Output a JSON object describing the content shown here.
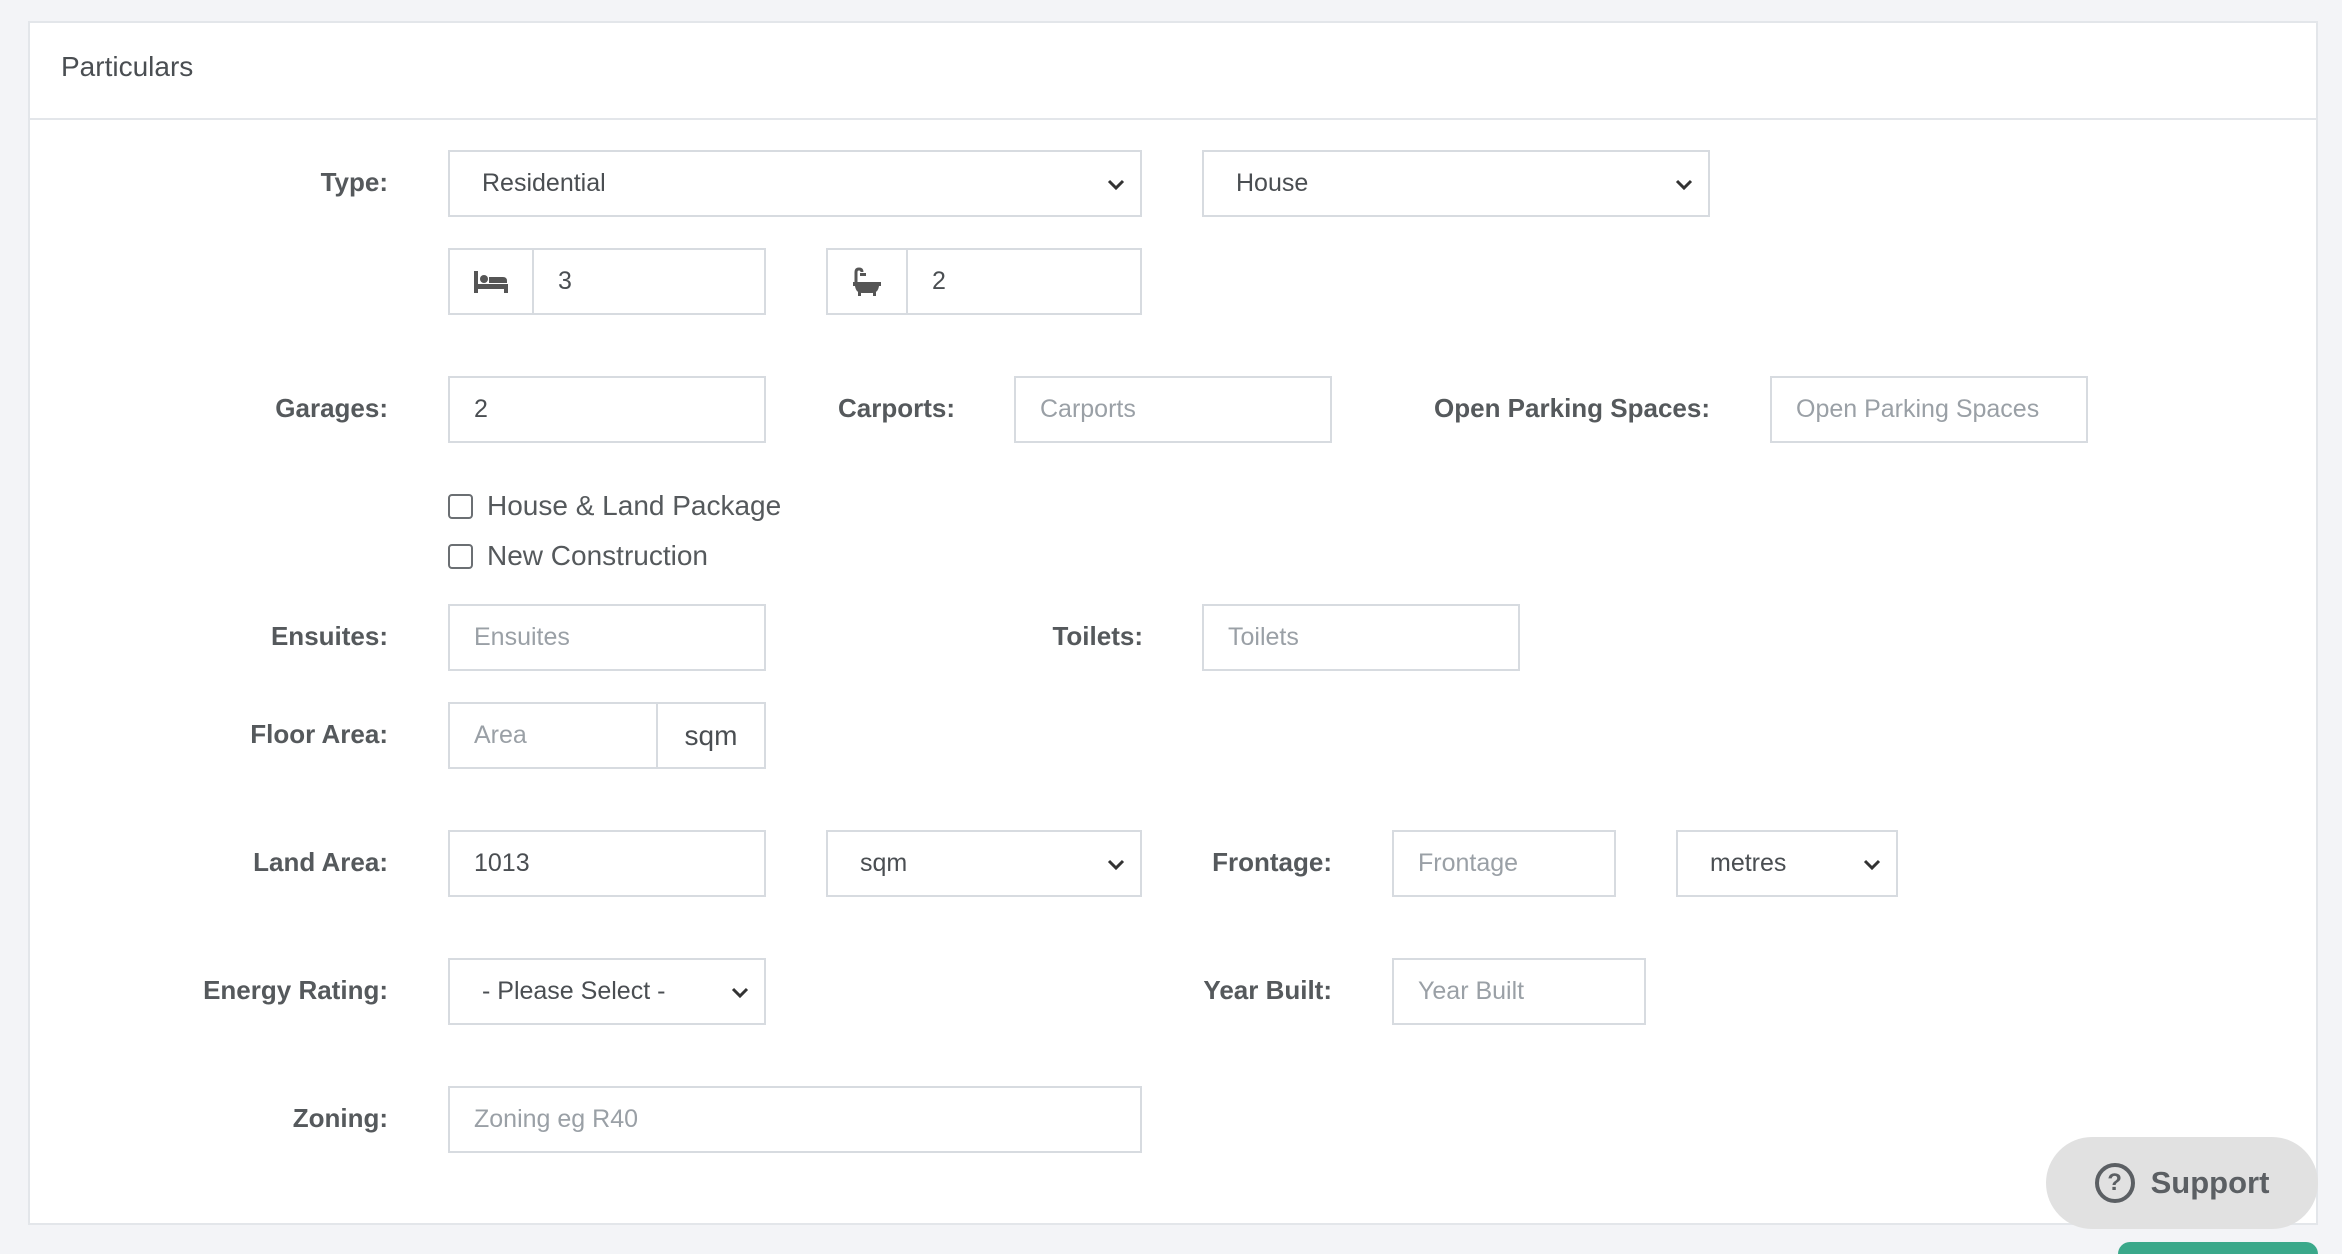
{
  "panel": {
    "title": "Particulars"
  },
  "labels": {
    "type": "Type:",
    "garages": "Garages:",
    "carports": "Carports:",
    "open_parking": "Open Parking Spaces:",
    "ensuites": "Ensuites:",
    "toilets": "Toilets:",
    "floor_area": "Floor Area:",
    "land_area": "Land Area:",
    "frontage": "Frontage:",
    "energy_rating": "Energy Rating:",
    "year_built": "Year Built:",
    "zoning": "Zoning:"
  },
  "fields": {
    "type_category": "Residential",
    "type_subtype": "House",
    "bedrooms": "3",
    "bathrooms": "2",
    "garages": "2",
    "carports_placeholder": "Carports",
    "open_parking_placeholder": "Open Parking Spaces",
    "ensuites_placeholder": "Ensuites",
    "toilets_placeholder": "Toilets",
    "floor_area_placeholder": "Area",
    "floor_area_unit": "sqm",
    "land_area": "1013",
    "land_area_unit": "sqm",
    "frontage_placeholder": "Frontage",
    "frontage_unit": "metres",
    "energy_rating": "- Please Select -",
    "year_built_placeholder": "Year Built",
    "zoning_placeholder": "Zoning eg R40"
  },
  "checkboxes": {
    "house_land_package": "House & Land Package",
    "new_construction": "New Construction"
  },
  "icons": {
    "bedrooms": "bed-icon",
    "bathrooms": "bath-icon",
    "support": "question-circle-icon"
  },
  "support": {
    "label": "Support",
    "glyph": "?"
  },
  "colors": {
    "support_bg": "#e1e1e1",
    "accent": "#3aa88a"
  }
}
